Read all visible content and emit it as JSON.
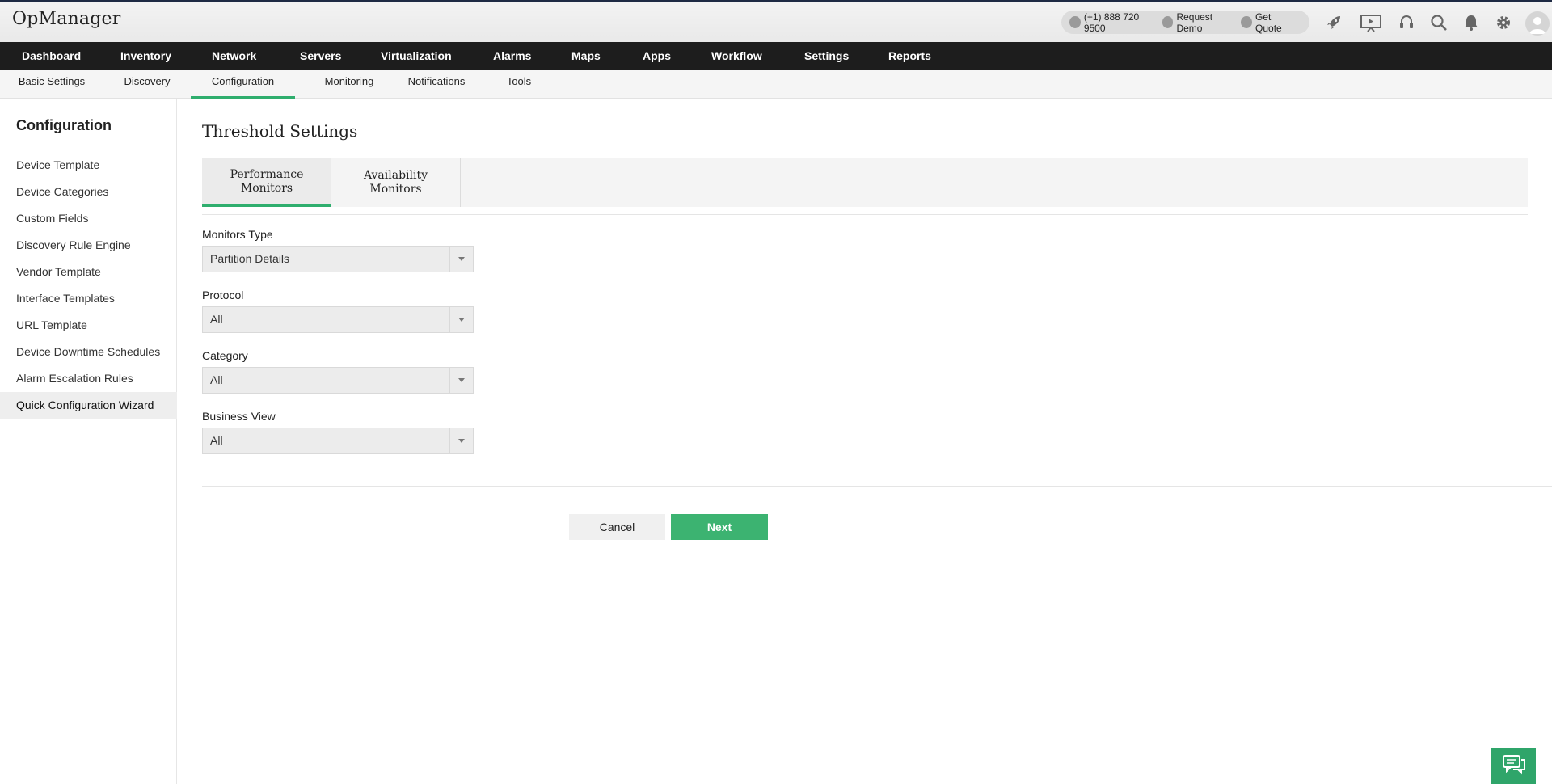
{
  "header": {
    "logo": "OpManager",
    "phone": "(+1) 888 720 9500",
    "request_demo": "Request Demo",
    "get_quote": "Get Quote",
    "icons": [
      "rocket-icon",
      "presentation-icon",
      "headset-icon",
      "search-icon",
      "bell-icon",
      "gear-icon",
      "user-avatar"
    ]
  },
  "main_nav": [
    "Dashboard",
    "Inventory",
    "Network",
    "Servers",
    "Virtualization",
    "Alarms",
    "Maps",
    "Apps",
    "Workflow",
    "Settings",
    "Reports"
  ],
  "sub_nav": {
    "items": [
      "Basic Settings",
      "Discovery",
      "Configuration",
      "Monitoring",
      "Notifications",
      "Tools"
    ],
    "active": "Configuration"
  },
  "sidebar": {
    "title": "Configuration",
    "items": [
      "Device Template",
      "Device Categories",
      "Custom Fields",
      "Discovery Rule Engine",
      "Vendor Template",
      "Interface Templates",
      "URL Template",
      "Device Downtime Schedules",
      "Alarm Escalation Rules",
      "Quick Configuration Wizard"
    ],
    "active": "Quick Configuration Wizard"
  },
  "page": {
    "title": "Threshold Settings",
    "tabs": [
      {
        "line1": "Performance",
        "line2": "Monitors",
        "active": true
      },
      {
        "line1": "Availability",
        "line2": "Monitors",
        "active": false
      }
    ],
    "fields": [
      {
        "label": "Monitors Type",
        "value": "Partition Details"
      },
      {
        "label": "Protocol",
        "value": "All"
      },
      {
        "label": "Category",
        "value": "All"
      },
      {
        "label": "Business View",
        "value": "All"
      }
    ],
    "cancel_label": "Cancel",
    "next_label": "Next"
  },
  "colors": {
    "accent_green": "#3cb371",
    "nav_bg": "#1d1d1d"
  }
}
